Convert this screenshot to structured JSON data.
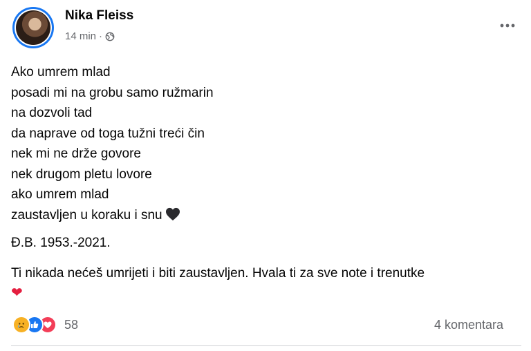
{
  "post": {
    "author": "Nika Fleiss",
    "time": "14 min",
    "privacy_icon": "globe-icon",
    "more_icon": "more-options-icon",
    "poem_lines": [
      "Ako umrem mlad",
      "posadi mi na grobu samo ružmarin",
      "na dozvoli tad",
      "da naprave od toga tužni treći čin",
      "nek mi ne drže govore",
      "nek drugom pletu lovore",
      "ako umrem mlad",
      "zaustavljen u koraku i snu"
    ],
    "signature": "Đ.B. 1953.-2021.",
    "tribute": "Ti nikada nećeš umrijeti i biti zaustavljen. Hvala ti za sve note i trenutke",
    "tribute_emoji": "❤",
    "reaction_icons": [
      "sad-reaction-icon",
      "like-reaction-icon",
      "love-reaction-icon"
    ],
    "reaction_count": "58",
    "comments": "4 komentara",
    "colors": {
      "like": "#1877f2",
      "love": "#f33e58",
      "sad": "#f7b125",
      "secondary_text": "#65676b"
    }
  }
}
